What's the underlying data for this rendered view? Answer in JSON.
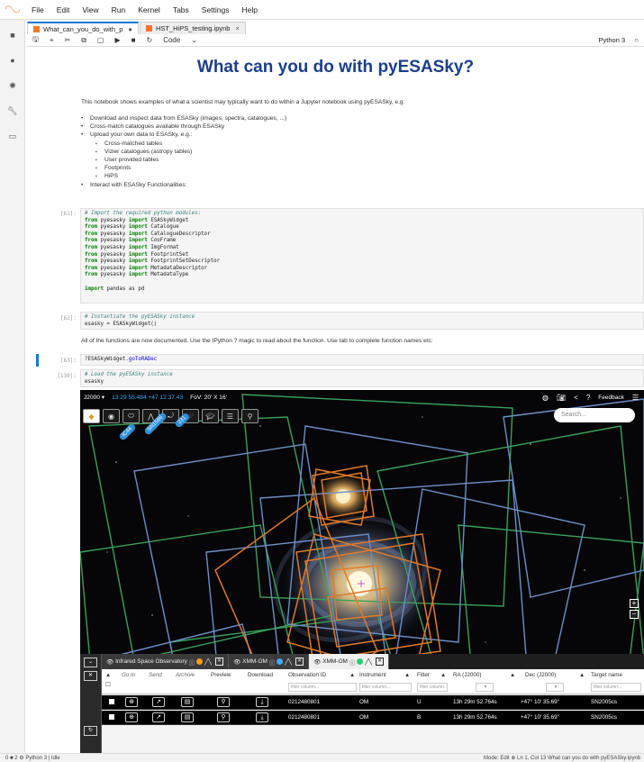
{
  "menubar": {
    "items": [
      "File",
      "Edit",
      "View",
      "Run",
      "Kernel",
      "Tabs",
      "Settings",
      "Help"
    ]
  },
  "tabs": [
    {
      "label": "What_can_you_do_with_p",
      "close": "●"
    },
    {
      "label": "HST_HiPS_testing.ipynb",
      "close": "×"
    }
  ],
  "toolbar": {
    "cell_type": "Code",
    "kernel": "Python 3"
  },
  "notebook": {
    "title": "What can you do with pyESASky?",
    "intro": "This notebook shows examples of what a scientist may typically want to do within a Jupyter notebook using pyESASky, e.g:",
    "bullets": [
      {
        "level": 1,
        "text": "Download and inspect data from ESASky (images, spectra, catalogues, ...)"
      },
      {
        "level": 1,
        "text": "Cross-match catalogues available through ESASky"
      },
      {
        "level": 1,
        "text": "Upload your own data to ESASky, e.g.:"
      },
      {
        "level": 2,
        "text": "Cross-matched tables"
      },
      {
        "level": 2,
        "text": "Vizier catalogues (astropy tables)"
      },
      {
        "level": 2,
        "text": "User provided tables"
      },
      {
        "level": 2,
        "text": "Footprints"
      },
      {
        "level": 2,
        "text": "HiPS"
      },
      {
        "level": 1,
        "text": "Interact with ESASky Functionalities:"
      }
    ],
    "cell1": {
      "prompt": "[61]:",
      "comment": "# Import the required python modules:",
      "imports": [
        "ESASkyWidget",
        "Catalogue",
        "CatalogueDescriptor",
        "CooFrame",
        "ImgFormat",
        "FootprintSet",
        "FootprintSetDescriptor",
        "MetadataDescriptor",
        "MetadataType"
      ],
      "last": "pandas as pd"
    },
    "cell2": {
      "prompt": "[62]:",
      "comment": "# Instantiate the pyESASky instance",
      "code": "esasky = ESASkyWidget()"
    },
    "md2": "All of the functions are now documented. Use the IPython ? magic to read about the function. Use tab to complete function names etc:",
    "cell3": {
      "prompt": "[63]:",
      "code_pre": "?ESASkyWidget.",
      "code_fn": "goToRADec"
    },
    "cell4": {
      "prompt": "[130]:",
      "comment": "# Load the pyESASky instance",
      "code": "esasky"
    }
  },
  "widget": {
    "frame": "J2000",
    "coords": "13 29 55.484 +47 12 37.43",
    "fov": "FoV: 20' X 16'",
    "feedback": "Feedback",
    "search_placeholder": "Search...",
    "badges": [
      "IC44",
      "SN1586",
      "231"
    ],
    "table_tabs": [
      {
        "label": "Infrared Space Observatory",
        "dot": "#f39c12"
      },
      {
        "label": "XMM-OM",
        "dot": "#3fa9f5"
      },
      {
        "label": "XMM-OM",
        "dot": "#2ecc71"
      }
    ],
    "headers": [
      "Go to",
      "Send",
      "Archive",
      "Preview",
      "Download",
      "Observation ID",
      "Instrument",
      "Filter",
      "RA (J2000)",
      "Dec (J2000)",
      "Target name"
    ],
    "filter_placeholder": "filter column...",
    "rows": [
      {
        "obs_id": "0212480801",
        "instrument": "OM",
        "filter": "U",
        "ra": "13h 29m 52.764s",
        "dec": "+47° 10' 35.69\"",
        "target": "SN2005cs"
      },
      {
        "obs_id": "0212480801",
        "instrument": "OM",
        "filter": "B",
        "ra": "13h 29m 52.764s",
        "dec": "+47° 10' 35.69\"",
        "target": "SN2005cs"
      }
    ]
  },
  "statusbar": {
    "left": "0  ■  2  ⚙  Python 3 | Idle",
    "right": "Mode: Edit  ⊕  Ln 1, Col 13  What can you do with pyESASky.ipynb"
  }
}
